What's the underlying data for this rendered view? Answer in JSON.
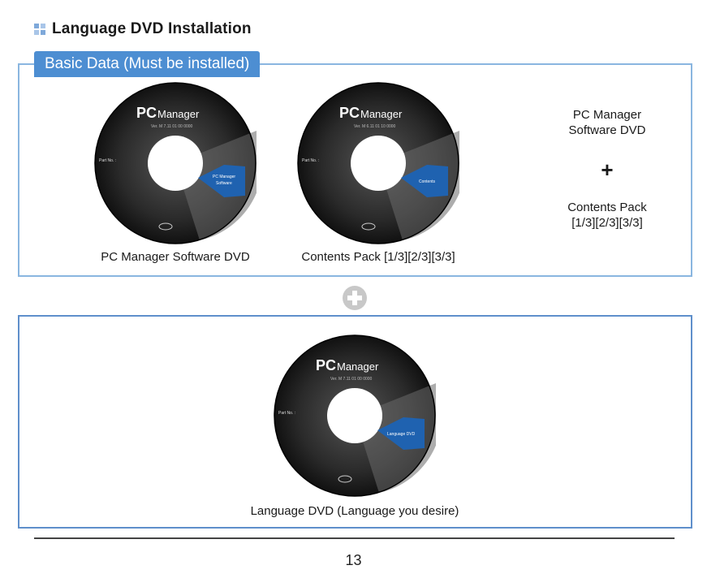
{
  "heading": {
    "title": "Language DVD Installation"
  },
  "basic_box": {
    "tab_label": "Basic Data (Must be installed)",
    "discs": [
      {
        "brand_pc": "PC",
        "brand_manager": "Manager",
        "version": "Ver. M 7.11 01 00 0000",
        "part_no": "Part No. :",
        "arrow_label_1": "PC Manager",
        "arrow_label_2": "Software",
        "caption": "PC Manager Software DVD"
      },
      {
        "brand_pc": "PC",
        "brand_manager": "Manager",
        "version": "Ver. M 6.11 01 10 0000",
        "part_no": "Part No. :",
        "arrow_label_1": "Contents",
        "arrow_label_2": "",
        "caption": "Contents Pack [1/3][2/3][3/3]"
      }
    ],
    "side": {
      "line1": "PC Manager",
      "line2": "Software DVD",
      "plus": "+",
      "line3": "Contents Pack",
      "line4": "[1/3][2/3][3/3]"
    }
  },
  "language_box": {
    "disc": {
      "brand_pc": "PC",
      "brand_manager": "Manager",
      "version": "Ver. M 7.11 01 00 0000",
      "part_no": "Part No. :",
      "arrow_label_1": "Language DVD",
      "caption": "Language DVD (Language you desire)"
    }
  },
  "footer": {
    "page_number": "13"
  },
  "colors": {
    "accent": "#4d8ed2",
    "box_border": "#8ab6e0",
    "arrow": "#1f62b0"
  }
}
